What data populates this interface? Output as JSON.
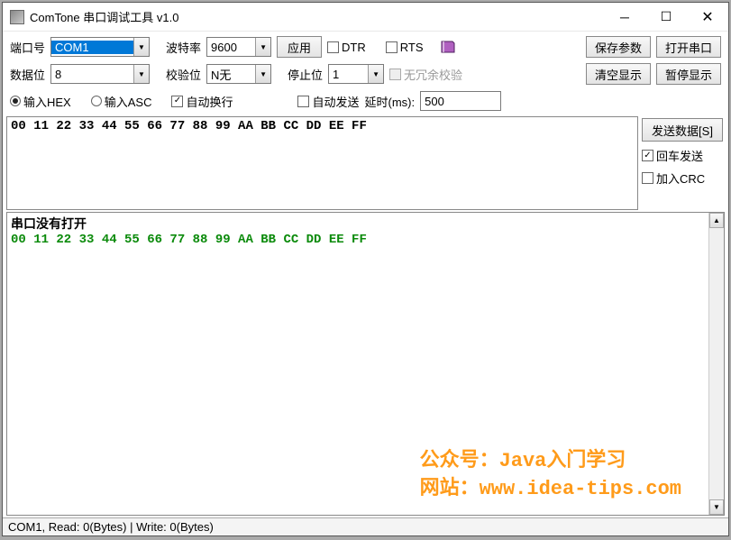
{
  "title": "ComTone 串口调试工具 v1.0",
  "config_row1": {
    "port_label": "端口号",
    "port_value": "COM1",
    "baud_label": "波特率",
    "baud_value": "9600",
    "apply_btn": "应用",
    "dtr": "DTR",
    "rts": "RTS",
    "save_params": "保存参数",
    "open_port": "打开串口"
  },
  "config_row2": {
    "databits_label": "数据位",
    "databits_value": "8",
    "parity_label": "校验位",
    "parity_value": "N无",
    "stopbits_label": "停止位",
    "stopbits_value": "1",
    "no_redundant_check": "无冗余校验",
    "clear_display": "清空显示",
    "pause_display": "暂停显示"
  },
  "config_row3": {
    "input_hex": "输入HEX",
    "input_asc": "输入ASC",
    "auto_wrap": "自动换行",
    "auto_send": "自动发送",
    "delay_label": "延时(ms):",
    "delay_value": "500"
  },
  "send": {
    "text": "00 11 22 33 44 55 66 77 88 99 AA BB CC DD EE FF",
    "send_btn": "发送数据[S]",
    "enter_send": "回车发送",
    "add_crc": "加入CRC"
  },
  "recv": {
    "line1": "串口没有打开",
    "line2": "00 11 22 33 44 55 66 77 88 99 AA BB CC DD EE FF"
  },
  "watermark": {
    "line1": "公众号：Java入门学习",
    "line2": "网站：www.idea-tips.com"
  },
  "status": "COM1, Read: 0(Bytes) | Write: 0(Bytes)"
}
